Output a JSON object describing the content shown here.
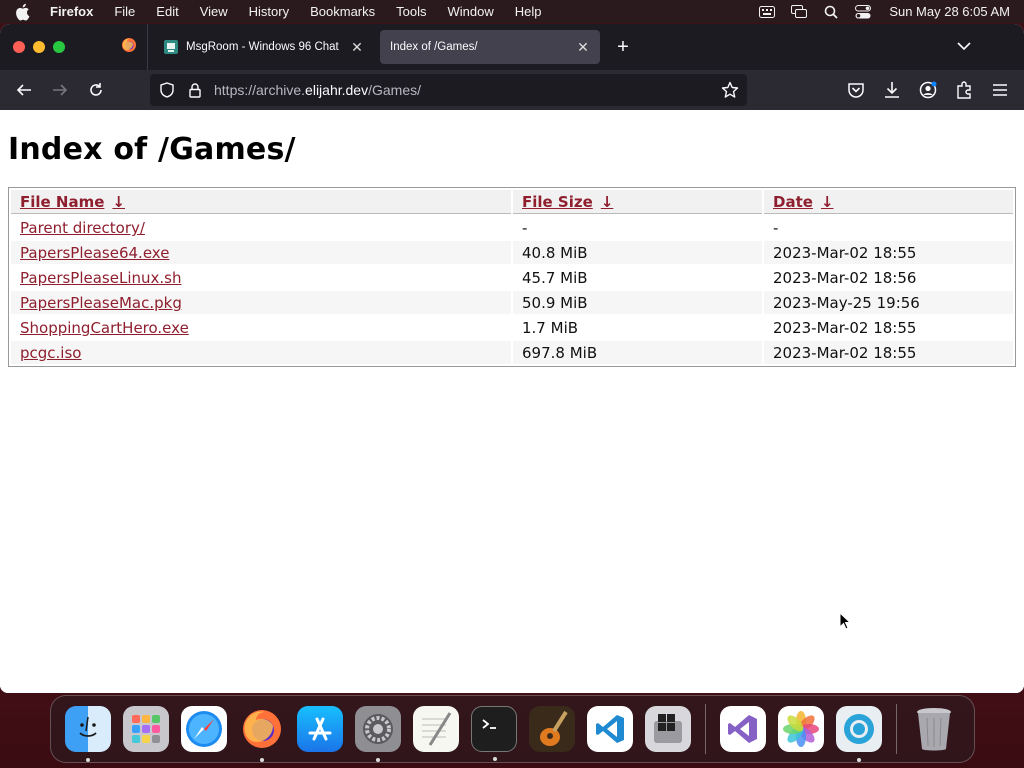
{
  "menubar": {
    "app_name": "Firefox",
    "items": [
      "File",
      "Edit",
      "View",
      "History",
      "Bookmarks",
      "Tools",
      "Window",
      "Help"
    ],
    "clock": "Sun May 28  6:05 AM"
  },
  "tabs": [
    {
      "title": "MsgRoom - Windows 96 Chat",
      "active": false
    },
    {
      "title": "Index of /Games/",
      "active": true
    }
  ],
  "urlbar": {
    "prefix": "https://archive.",
    "domain": "elijahr.dev",
    "path": "/Games/"
  },
  "page": {
    "heading": "Index of /Games/",
    "columns": {
      "name": "File Name",
      "size": "File Size",
      "date": "Date",
      "arrow": "↓"
    },
    "rows": [
      {
        "name": "Parent directory/",
        "size": "-",
        "date": "-"
      },
      {
        "name": "PapersPlease64.exe",
        "size": "40.8 MiB",
        "date": "2023-Mar-02 18:55"
      },
      {
        "name": "PapersPleaseLinux.sh",
        "size": "45.7 MiB",
        "date": "2023-Mar-02 18:56"
      },
      {
        "name": "PapersPleaseMac.pkg",
        "size": "50.9 MiB",
        "date": "2023-May-25 19:56"
      },
      {
        "name": "ShoppingCartHero.exe",
        "size": "1.7 MiB",
        "date": "2023-Mar-02 18:55"
      },
      {
        "name": "pcgc.iso",
        "size": "697.8 MiB",
        "date": "2023-Mar-02 18:55"
      }
    ]
  },
  "dock": {
    "apps": [
      "finder-icon",
      "launchpad-icon",
      "safari-icon",
      "firefox-icon",
      "app-store-icon",
      "system-settings-icon",
      "textedit-icon",
      "terminal-icon",
      "garageband-icon",
      "vscode-icon",
      "boot-camp-icon",
      "visual-studio-icon",
      "photos-icon",
      "proxyman-icon",
      "trash-icon"
    ],
    "running": [
      "finder-icon",
      "firefox-icon",
      "system-settings-icon",
      "terminal-icon",
      "proxyman-icon"
    ]
  },
  "colors": {
    "link": "#8f1f2e",
    "tabbar_bg": "#1c1b22",
    "navbar_bg": "#2b2a33",
    "desktop_bg": "#4a111a"
  }
}
